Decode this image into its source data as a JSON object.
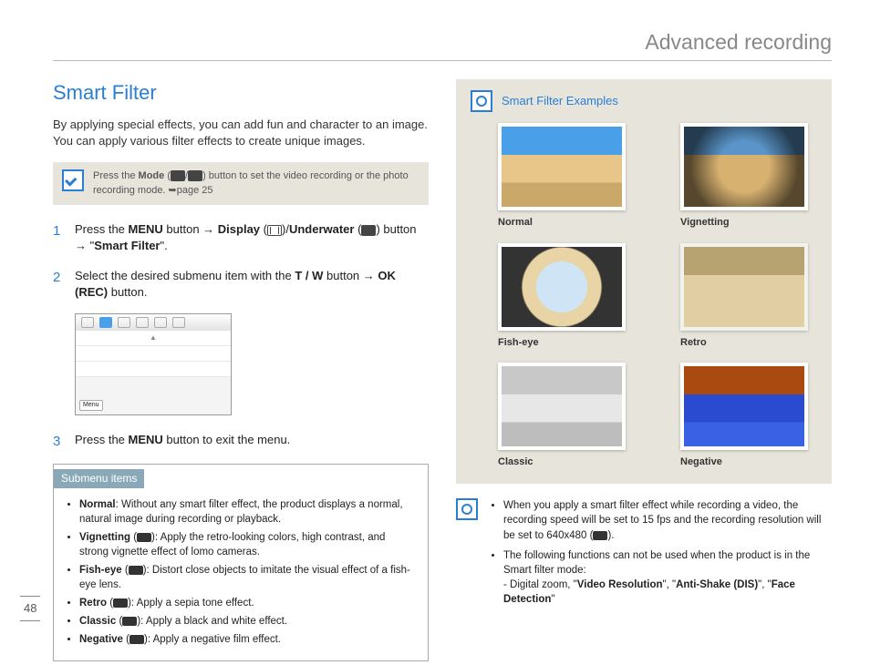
{
  "header": {
    "title": "Advanced recording"
  },
  "page_number": "48",
  "left": {
    "section_title": "Smart Filter",
    "intro": "By applying special effects, you can add fun and character to an image. You can apply various filter effects to create unique images.",
    "mode_note_prefix": "Press the ",
    "mode_note_bold": "Mode",
    "mode_note_mid": " (",
    "mode_note_suffix": ") button to set the video recording or the photo recording mode. ➥page 25",
    "steps": {
      "s1": {
        "num": "1",
        "t1": "Press the ",
        "menu": "MENU",
        "t2": " button → ",
        "display": "Display",
        "t3": " (",
        "t4": ")/",
        "underwater": "Underwater",
        "t5": " (",
        "t6": ") button → \"",
        "smart": "Smart Filter",
        "t7": "\"."
      },
      "s2": {
        "num": "2",
        "t1": "Select the desired submenu item with the ",
        "tw": "T / W",
        "t2": " button → ",
        "ok": "OK (REC)",
        "t3": " button."
      },
      "s3": {
        "num": "3",
        "t1": "Press the ",
        "menu": "MENU",
        "t2": " button to exit the menu."
      }
    },
    "submenu": {
      "header": "Submenu items",
      "items": [
        {
          "name": "Normal",
          "desc": ": Without any smart filter effect, the product displays a normal, natural image during recording or playback.",
          "badge": false
        },
        {
          "name": "Vignetting",
          "desc": ": Apply the retro-looking colors, high contrast, and strong vignette effect of lomo cameras.",
          "badge": true
        },
        {
          "name": "Fish-eye",
          "desc": ": Distort close objects to imitate the visual effect of a fish-eye lens.",
          "badge": true
        },
        {
          "name": "Retro",
          "desc": ": Apply a sepia tone effect.",
          "badge": true
        },
        {
          "name": "Classic",
          "desc": ": Apply a black and white effect.",
          "badge": true
        },
        {
          "name": "Negative",
          "desc": ": Apply a negative film effect.",
          "badge": true
        }
      ]
    }
  },
  "right": {
    "examples_title": "Smart Filter Examples",
    "thumbs": [
      {
        "caption": "Normal",
        "cls": "img-normal"
      },
      {
        "caption": "Vignetting",
        "cls": "img-vignetting"
      },
      {
        "caption": "Fish-eye",
        "cls": "img-fisheye"
      },
      {
        "caption": "Retro",
        "cls": "img-retro"
      },
      {
        "caption": "Classic",
        "cls": "img-classic"
      },
      {
        "caption": "Negative",
        "cls": "img-negative"
      }
    ],
    "footer": {
      "n1a": "When you apply a smart filter effect while recording a video, the recording speed will be set to 15 fps and the recording resolution will be set to 640x480 (",
      "n1b": ").",
      "n2": "The following functions can not be used when the product is in the Smart filter mode:",
      "n2sub_prefix": "- Digital zoom, \"",
      "vr": "Video Resolution",
      "mid1": "\", \"",
      "as": "Anti-Shake (DIS)",
      "mid2": "\", \"",
      "fd": "Face Detection",
      "suffix": "\""
    }
  }
}
